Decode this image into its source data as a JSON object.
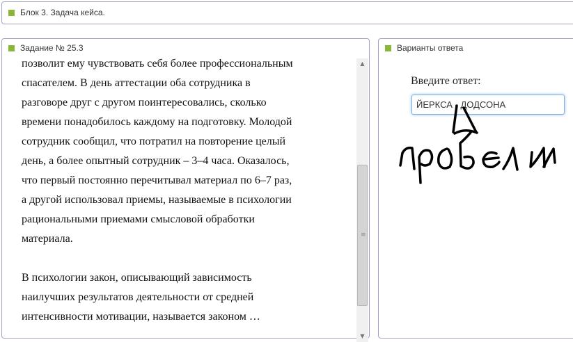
{
  "block_header": {
    "title": "Блок 3. Задача кейса."
  },
  "task_panel": {
    "title": "Задание № 25.3",
    "paragraphs": [
      [
        "позволит ему чувствовать себя более профессиональным",
        "спасателем. В день аттестации оба сотрудника в",
        "разговоре друг с другом поинтересовались, сколько",
        "времени понадобилось каждому на подготовку. Молодой",
        "сотрудник сообщил, что потратил на повторение целый",
        "день, а более опытный сотрудник – 3–4 часа. Оказалось,",
        "что первый постоянно перечитывал материал по 6–7 раз,",
        "а другой использовал приемы, называемые в психологии",
        "рациональными приемами смысловой обработки",
        "материала."
      ],
      [
        "В психологии закон, описывающий зависимость",
        "наилучших результатов деятельности от средней",
        "интенсивности мотивации, называется законом …"
      ]
    ]
  },
  "answer_panel": {
    "title": "Варианты ответа",
    "prompt": "Введите ответ:",
    "input_value": "ЙЕРКСА - ДОДСОНА",
    "annotation": "пробели"
  },
  "icons": {
    "panel_marker": "green-square-icon",
    "scroll_up": "scroll-up-arrow-icon",
    "scroll_down": "scroll-down-arrow-icon"
  },
  "colors": {
    "panel_marker": "#8ab63a",
    "panel_border": "#9fa3c8",
    "input_focus": "#7fb2de",
    "annotation_ink": "#000000"
  }
}
